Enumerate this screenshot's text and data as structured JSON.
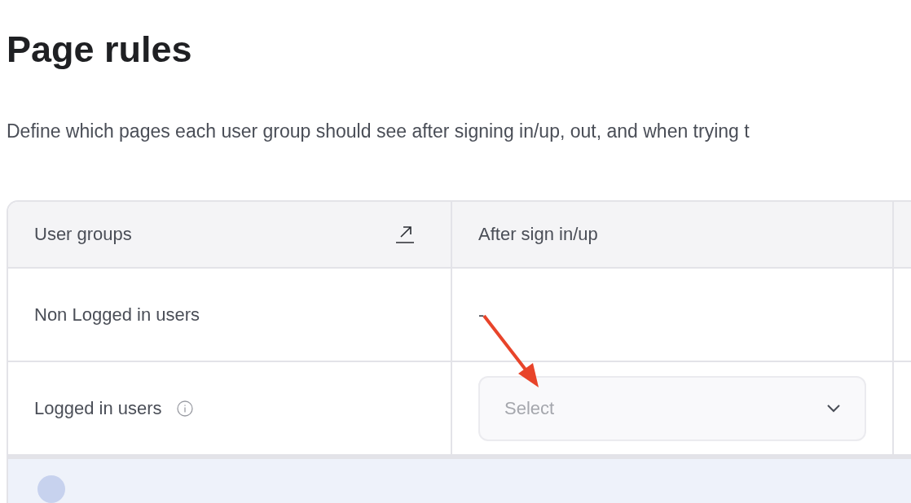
{
  "page": {
    "title": "Page rules",
    "description": "Define which pages each user group should see after signing in/up, out, and when trying t"
  },
  "table": {
    "columns": [
      "User groups",
      "After sign in/up"
    ],
    "rows": [
      {
        "group": "Non Logged in users",
        "info": false,
        "after_sign_in": {
          "kind": "text",
          "value": "-"
        }
      },
      {
        "group": "Logged in users",
        "info": true,
        "after_sign_in": {
          "kind": "select",
          "placeholder": "Select"
        }
      }
    ]
  }
}
